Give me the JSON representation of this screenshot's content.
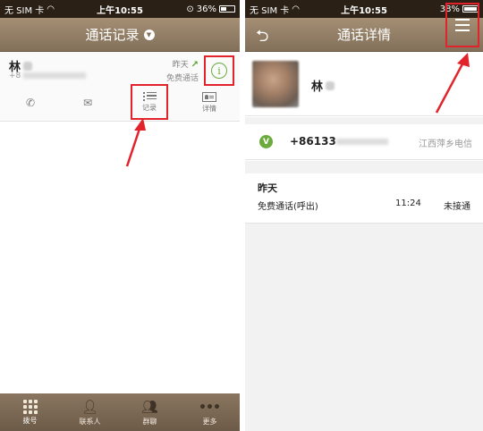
{
  "left": {
    "status": {
      "carrier": "无 SIM 卡",
      "time": "上午10:55",
      "battery": "36%"
    },
    "nav": {
      "title": "通话记录"
    },
    "call": {
      "name": "林",
      "number_prefix": "+8",
      "time": "昨天",
      "type": "免费通话",
      "actions": {
        "records_label": "记录",
        "details_label": "详情"
      }
    },
    "tabs": [
      {
        "label": "拨号"
      },
      {
        "label": "联系人"
      },
      {
        "label": "群聊"
      },
      {
        "label": "更多"
      }
    ]
  },
  "right": {
    "status": {
      "carrier": "无 SIM 卡",
      "time": "上午10:55",
      "battery": "38%"
    },
    "nav": {
      "title": "通话详情"
    },
    "contact": {
      "name": "林"
    },
    "phone": {
      "badge": "V",
      "number_prefix": "+86133",
      "carrier": "江西萍乡电信"
    },
    "record": {
      "date": "昨天",
      "type": "免费通话(呼出)",
      "time": "11:24",
      "status": "未接通"
    }
  },
  "colors": {
    "accent_green": "#6bab3e",
    "highlight_red": "#e3232b",
    "nav_brown": "#8f7b63"
  }
}
